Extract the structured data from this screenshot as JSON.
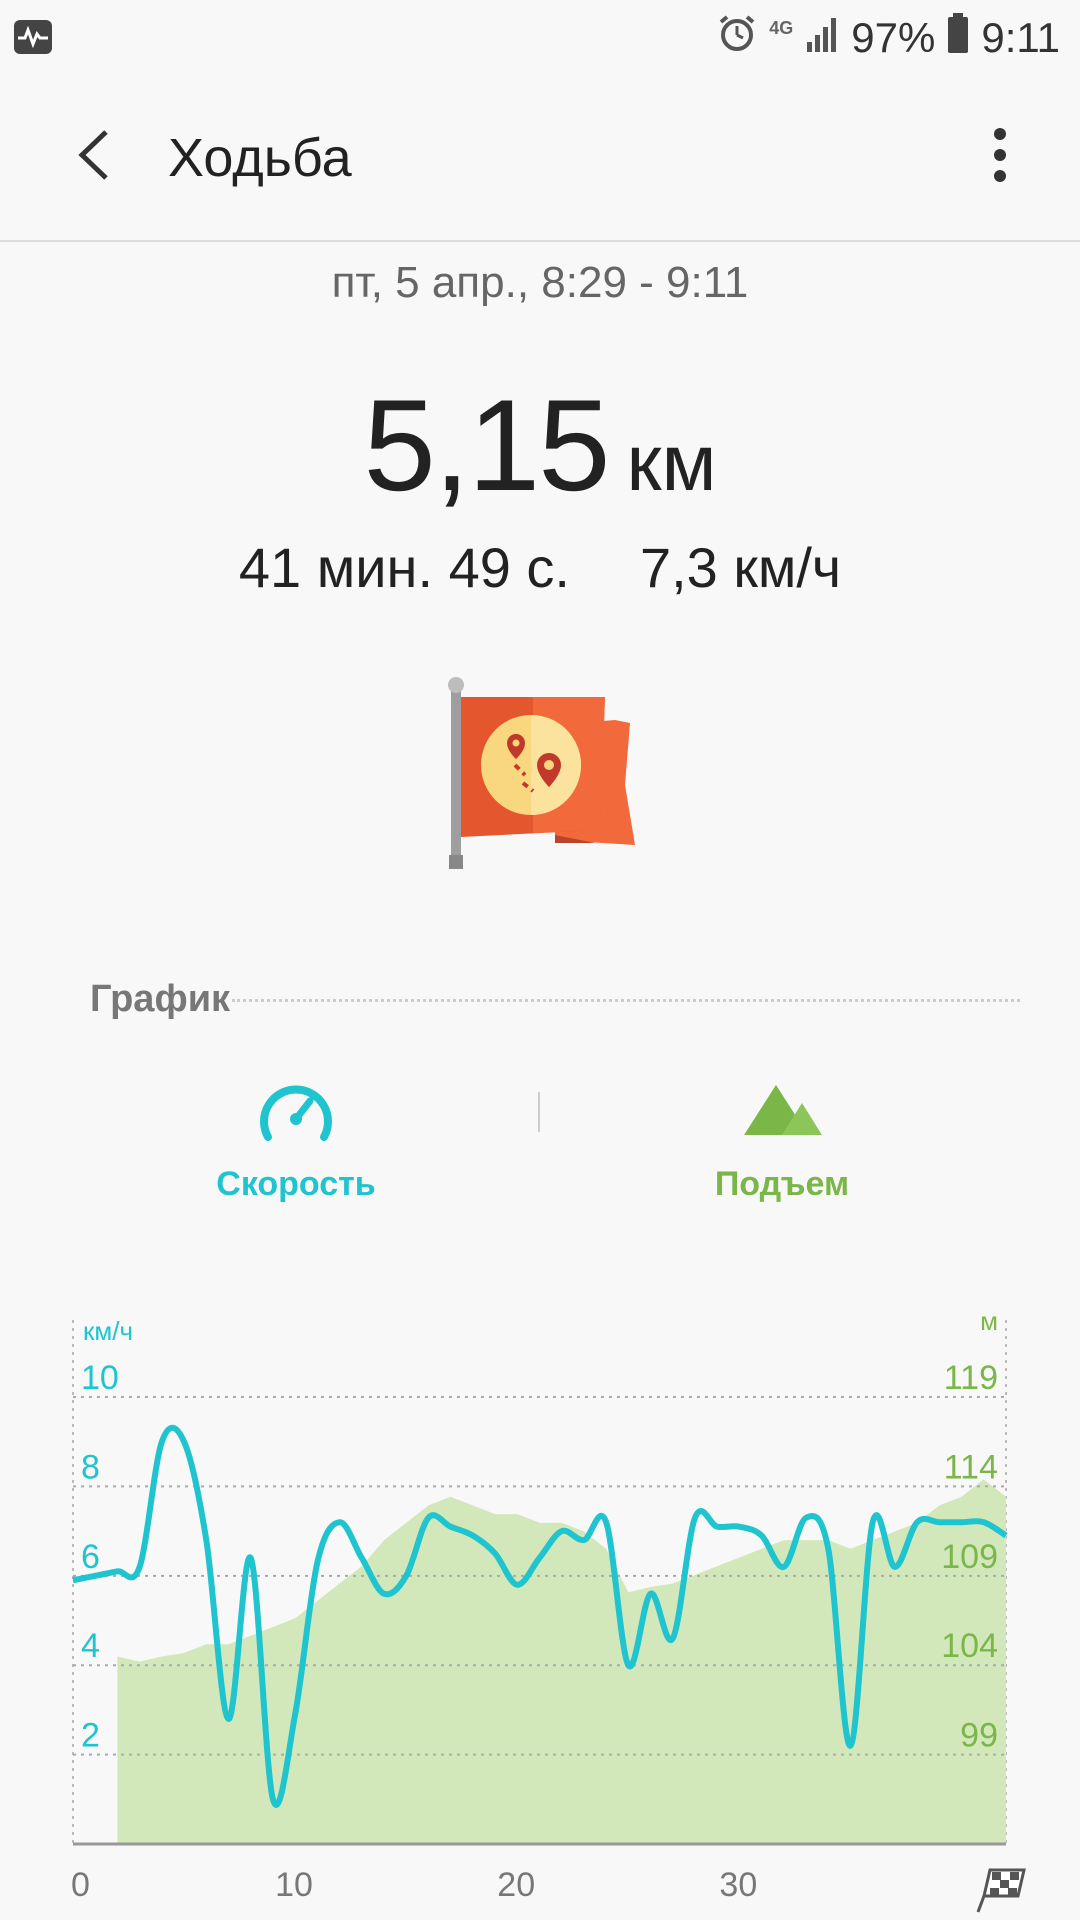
{
  "status_bar": {
    "network": "4G",
    "battery": "97%",
    "time": "9:11",
    "icons": [
      "health-icon",
      "alarm-icon",
      "signal-icon",
      "battery-icon"
    ]
  },
  "app_bar": {
    "title": "Ходьба",
    "back_icon": "back-arrow-icon",
    "menu_icon": "more-vert-icon"
  },
  "summary": {
    "date": "пт, 5 апр., 8:29 - 9:11",
    "distance_value": "5,15",
    "distance_unit": "км",
    "duration": "41 мин. 49 с.",
    "avg_speed": "7,3 км/ч",
    "badge_icon": "route-flag-icon"
  },
  "graph_section": {
    "title": "График",
    "tabs": [
      {
        "label": "Скорость",
        "icon": "speedometer-icon",
        "color": "#1fc4cf"
      },
      {
        "label": "Подъем",
        "icon": "mountain-icon",
        "color": "#7ab648"
      }
    ]
  },
  "chart_data": {
    "type": "line",
    "left_axis": {
      "unit": "км/ч",
      "ticks": [
        "10",
        "8",
        "6",
        "4",
        "2"
      ],
      "range": [
        0,
        11.5
      ]
    },
    "right_axis": {
      "unit": "м",
      "ticks": [
        "119",
        "114",
        "109",
        "104",
        "99"
      ],
      "range": [
        92,
        121.6
      ]
    },
    "x_ticks": [
      "0",
      "10",
      "20",
      "30"
    ],
    "x_range": [
      0,
      42
    ],
    "end_icon": "finish-flag-icon",
    "grid": true,
    "series": [
      {
        "axis": "left",
        "color": "#1fc4cf",
        "x": [
          0,
          1,
          2,
          3,
          4,
          5,
          6,
          7,
          8,
          9,
          10,
          11,
          12,
          13,
          14,
          15,
          16,
          17,
          18,
          19,
          20,
          21,
          22,
          23,
          24,
          25,
          26,
          27,
          28,
          29,
          30,
          31,
          32,
          33,
          34,
          35,
          36,
          37,
          38,
          39,
          40,
          41,
          42
        ],
        "values": [
          5.9,
          6.0,
          6.1,
          6.2,
          9.0,
          9.0,
          6.8,
          2.8,
          6.4,
          1.0,
          2.9,
          6.3,
          7.2,
          6.4,
          5.6,
          6.0,
          7.3,
          7.1,
          6.9,
          6.5,
          5.8,
          6.4,
          7.0,
          6.8,
          7.2,
          4.0,
          5.6,
          4.6,
          7.3,
          7.1,
          7.1,
          6.9,
          6.2,
          7.3,
          6.6,
          2.2,
          7.2,
          6.2,
          7.2,
          7.2,
          7.2,
          7.2,
          6.9
        ]
      },
      {
        "axis": "right",
        "color": "#d2e8bb",
        "type": "area",
        "x": [
          2,
          3,
          4,
          5,
          6,
          7,
          8,
          9,
          10,
          11,
          12,
          13,
          14,
          15,
          16,
          17,
          18,
          19,
          20,
          21,
          22,
          23,
          24,
          25,
          26,
          27,
          28,
          29,
          30,
          31,
          32,
          33,
          34,
          35,
          36,
          37,
          38,
          39,
          40,
          41,
          42
        ],
        "values": [
          102.8,
          102.5,
          102.8,
          103.0,
          103.5,
          103.5,
          104.0,
          104.5,
          105.0,
          106.0,
          107.0,
          108.0,
          109.5,
          110.5,
          111.5,
          112.0,
          111.5,
          111.0,
          111.0,
          110.5,
          110.5,
          110.0,
          109.0,
          106.5,
          106.8,
          107.0,
          107.5,
          108.0,
          108.5,
          109.0,
          109.5,
          109.5,
          109.5,
          109.0,
          109.5,
          110.0,
          110.5,
          111.5,
          112.0,
          113.0,
          112.0
        ]
      }
    ]
  }
}
